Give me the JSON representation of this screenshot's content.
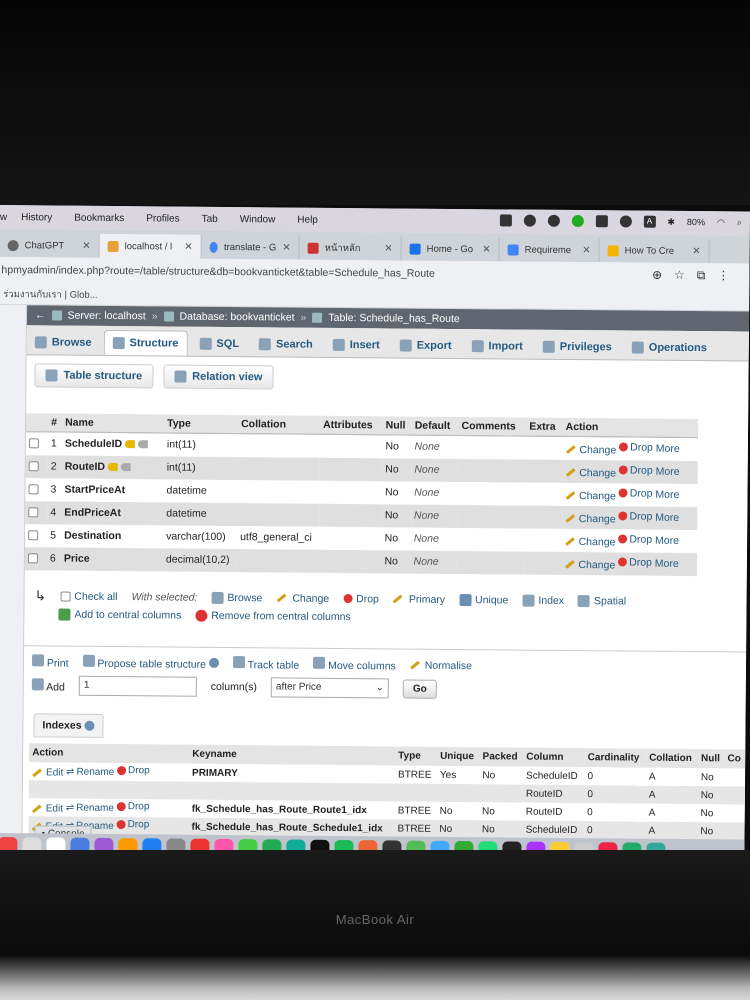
{
  "menubar": {
    "items": [
      "w",
      "History",
      "Bookmarks",
      "Profiles",
      "Tab",
      "Window",
      "Help"
    ],
    "battery": "80%",
    "input_badge": "A"
  },
  "tabs": [
    {
      "label": "ChatGPT",
      "color": "#555"
    },
    {
      "label": "localhost / l",
      "color": "#e8a13a"
    },
    {
      "label": "translate - G",
      "color": "#4285f4"
    },
    {
      "label": "หน้าหลัก",
      "color": "#c33"
    },
    {
      "label": "Home - Go",
      "color": "#1a73e8"
    },
    {
      "label": "Requireme",
      "color": "#4285f4"
    },
    {
      "label": "How To Cre",
      "color": "#f4b400"
    }
  ],
  "address": {
    "url": "hpmyadmin/index.php?route=/table/structure&db=bookvanticket&table=Schedule_has_Route"
  },
  "bookmarks": {
    "item": "ร่วมงานกับเรา | Glob..."
  },
  "breadcrumb": {
    "server": "Server: localhost",
    "database": "Database: bookvanticket",
    "table": "Table: Schedule_has_Route"
  },
  "top_tabs": [
    "Browse",
    "Structure",
    "SQL",
    "Search",
    "Insert",
    "Export",
    "Import",
    "Privileges",
    "Operations"
  ],
  "sub_tabs": [
    "Table structure",
    "Relation view"
  ],
  "structure": {
    "headers": [
      "#",
      "Name",
      "Type",
      "Collation",
      "Attributes",
      "Null",
      "Default",
      "Comments",
      "Extra",
      "Action"
    ],
    "rows": [
      {
        "num": "1",
        "name": "ScheduleID",
        "type": "int(11)",
        "collation": "",
        "null": "No",
        "default": "None"
      },
      {
        "num": "2",
        "name": "RouteID",
        "type": "int(11)",
        "collation": "",
        "null": "No",
        "default": "None"
      },
      {
        "num": "3",
        "name": "StartPriceAt",
        "type": "datetime",
        "collation": "",
        "null": "No",
        "default": "None"
      },
      {
        "num": "4",
        "name": "EndPriceAt",
        "type": "datetime",
        "collation": "",
        "null": "No",
        "default": "None"
      },
      {
        "num": "5",
        "name": "Destination",
        "type": "varchar(100)",
        "collation": "utf8_general_ci",
        "null": "No",
        "default": "None"
      },
      {
        "num": "6",
        "name": "Price",
        "type": "decimal(10,2)",
        "collation": "",
        "null": "No",
        "default": "None"
      }
    ],
    "action_change": "Change",
    "action_drop": "Drop",
    "action_more": "More"
  },
  "with_selected": {
    "check_all": "Check all",
    "label": "With selected:",
    "browse": "Browse",
    "change": "Change",
    "drop": "Drop",
    "primary": "Primary",
    "unique": "Unique",
    "index": "Index",
    "spatial": "Spatial",
    "add_central": "Add to central columns",
    "remove_central": "Remove from central columns"
  },
  "tools": {
    "print": "Print",
    "propose": "Propose table structure",
    "track": "Track table",
    "move": "Move columns",
    "normalise": "Normalise",
    "add": "Add",
    "add_count": "1",
    "columns_label": "column(s)",
    "position": "after Price",
    "go": "Go"
  },
  "indexes": {
    "title": "Indexes",
    "headers": [
      "Action",
      "Keyname",
      "Type",
      "Unique",
      "Packed",
      "Column",
      "Cardinality",
      "Collation",
      "Null",
      "Co"
    ],
    "edit": "Edit",
    "rename": "Rename",
    "drop": "Drop",
    "rows": [
      {
        "keyname": "PRIMARY",
        "type": "BTREE",
        "unique": "Yes",
        "packed": "No",
        "column": "ScheduleID",
        "cardinality": "0",
        "collation": "A",
        "null": "No"
      },
      {
        "keyname": "",
        "type": "",
        "unique": "",
        "packed": "",
        "column": "RouteID",
        "cardinality": "0",
        "collation": "A",
        "null": "No"
      },
      {
        "keyname": "fk_Schedule_has_Route_Route1_idx",
        "type": "BTREE",
        "unique": "No",
        "packed": "No",
        "column": "RouteID",
        "cardinality": "0",
        "collation": "A",
        "null": "No"
      },
      {
        "keyname": "fk_Schedule_has_Route_Schedule1_idx",
        "type": "BTREE",
        "unique": "No",
        "packed": "No",
        "column": "ScheduleID",
        "cardinality": "0",
        "collation": "A",
        "null": "No"
      }
    ],
    "console": "Console"
  },
  "laptop": {
    "brand": "MacBook Air"
  },
  "dock_colors": [
    "#e44",
    "#ddd",
    "#fff",
    "#4a7de0",
    "#a05ad8",
    "#f90",
    "#1e7ef2",
    "#888",
    "#e33",
    "#f5a",
    "#4c4",
    "#2a5",
    "#1a9",
    "#111",
    "#1db954",
    "#e63",
    "#333",
    "#5b5",
    "#4af",
    "#3a3",
    "#2d7",
    "#222",
    "#a3f",
    "#fc3",
    "#ccc",
    "#e24",
    "#2a6",
    "#3a9"
  ]
}
